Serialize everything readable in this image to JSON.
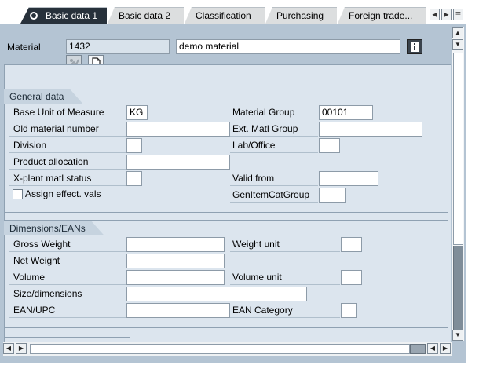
{
  "tabs": [
    {
      "label": "Basic data 1",
      "active": true
    },
    {
      "label": "Basic data 2",
      "active": false
    },
    {
      "label": "Classification",
      "active": false
    },
    {
      "label": "Purchasing",
      "active": false
    },
    {
      "label": "Foreign trade...",
      "active": false
    }
  ],
  "header": {
    "material_label": "Material",
    "material_number": "1432",
    "material_description": "demo material"
  },
  "general_data": {
    "title": "General data",
    "base_uom_label": "Base Unit of Measure",
    "base_uom_value": "KG",
    "material_group_label": "Material Group",
    "material_group_value": "00101",
    "old_matl_label": "Old material number",
    "old_matl_value": "",
    "ext_matl_group_label": "Ext. Matl Group",
    "ext_matl_group_value": "",
    "division_label": "Division",
    "division_value": "",
    "lab_office_label": "Lab/Office",
    "lab_office_value": "",
    "product_alloc_label": "Product allocation",
    "product_alloc_value": "",
    "xplant_label": "X-plant matl status",
    "xplant_value": "",
    "valid_from_label": "Valid from",
    "valid_from_value": "",
    "assign_effect_label": "Assign effect. vals",
    "assign_effect_checked": false,
    "gen_item_cat_label": "GenItemCatGroup",
    "gen_item_cat_value": ""
  },
  "dimensions": {
    "title": "Dimensions/EANs",
    "gross_weight_label": "Gross Weight",
    "gross_weight_value": "",
    "weight_unit_label": "Weight unit",
    "weight_unit_value": "",
    "net_weight_label": "Net Weight",
    "net_weight_value": "",
    "volume_label": "Volume",
    "volume_value": "",
    "volume_unit_label": "Volume unit",
    "volume_unit_value": "",
    "size_dim_label": "Size/dimensions",
    "size_dim_value": "",
    "ean_upc_label": "EAN/UPC",
    "ean_upc_value": "",
    "ean_category_label": "EAN Category",
    "ean_category_value": ""
  },
  "colors": {
    "active_tab": "#27313b",
    "panel": "#b4c4d3",
    "canvas": "#dce5ee"
  },
  "icons": {
    "info": "info-icon",
    "additional_data": "additional-data-icon",
    "document": "document-icon"
  }
}
